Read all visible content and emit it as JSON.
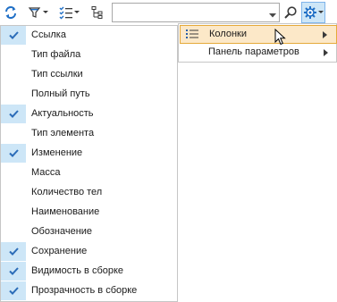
{
  "toolbar": {
    "buttons": [
      {
        "icon": "refresh-icon"
      },
      {
        "icon": "filter-icon"
      },
      {
        "icon": "checklist-icon"
      },
      {
        "icon": "tree-structure-icon"
      },
      {
        "icon": "search-icon"
      },
      {
        "icon": "gear-icon"
      }
    ],
    "search_value": ""
  },
  "submenu": {
    "items": [
      {
        "label": "Колонки",
        "icon": "list-icon",
        "highlighted": true
      },
      {
        "label": "Панель параметров",
        "highlighted": false
      }
    ]
  },
  "columns_menu": {
    "items": [
      {
        "label": "Ссылка",
        "checked": true
      },
      {
        "label": "Тип файла",
        "checked": false
      },
      {
        "label": "Тип ссылки",
        "checked": false
      },
      {
        "label": "Полный путь",
        "checked": false
      },
      {
        "label": "Актуальность",
        "checked": true
      },
      {
        "label": "Тип элемента",
        "checked": false
      },
      {
        "label": "Изменение",
        "checked": true
      },
      {
        "label": "Масса",
        "checked": false
      },
      {
        "label": "Количество тел",
        "checked": false
      },
      {
        "label": "Наименование",
        "checked": false
      },
      {
        "label": "Обозначение",
        "checked": false
      },
      {
        "label": "Сохранение",
        "checked": true
      },
      {
        "label": "Видимость в сборке",
        "checked": true
      },
      {
        "label": "Прозрачность в сборке",
        "checked": true
      }
    ]
  },
  "colors": {
    "check_bg": "#cde6f7",
    "check_mark": "#2b6cb8",
    "highlight_bg": "#fce8c8",
    "highlight_border": "#e5a93a",
    "icon_blue": "#1f6fc6"
  }
}
